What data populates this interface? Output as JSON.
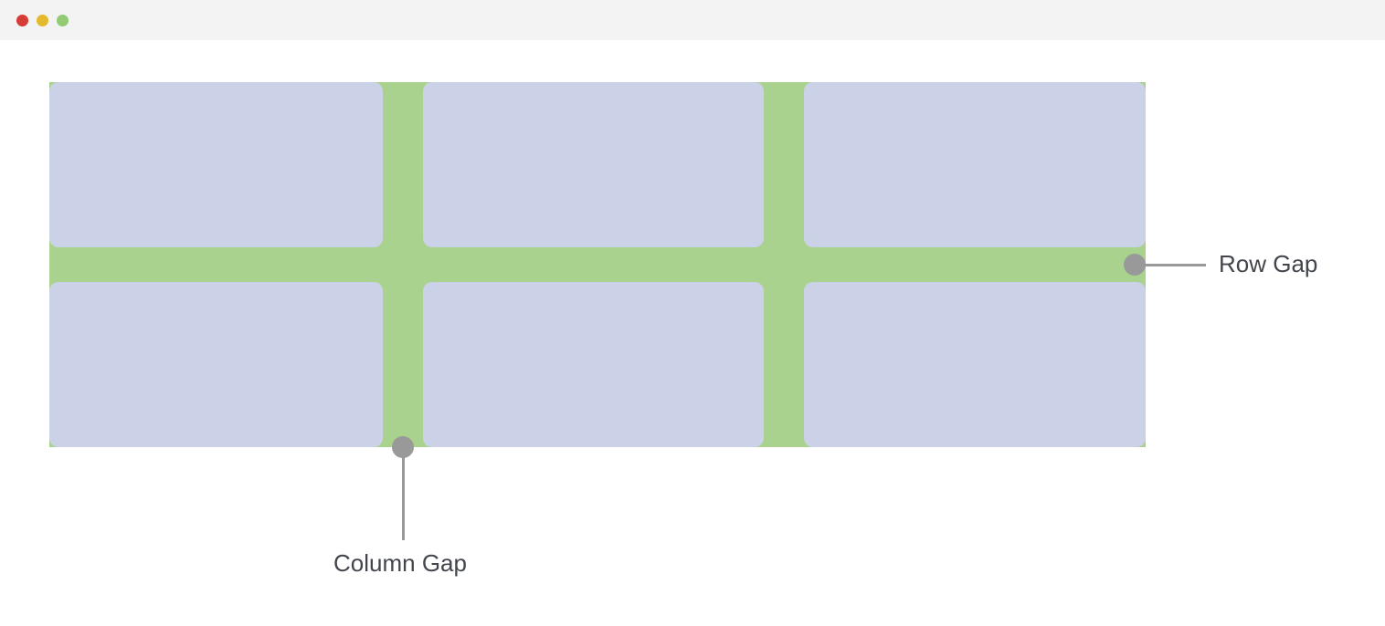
{
  "diagram": {
    "labels": {
      "row_gap": "Row Gap",
      "column_gap": "Column Gap"
    },
    "grid": {
      "cols": 3,
      "rows": 2,
      "cell_color": "#cbd2e7",
      "gap_color": "#a9d28e",
      "cell_radius_px": 10
    }
  }
}
